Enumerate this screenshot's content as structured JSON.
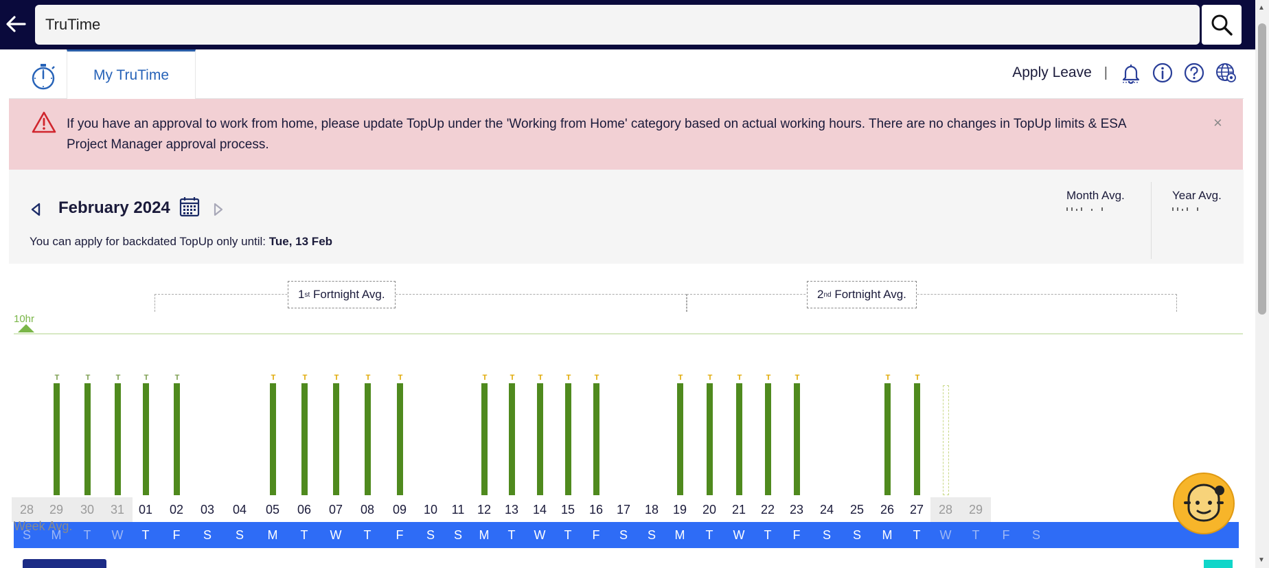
{
  "search": {
    "value": "TruTime"
  },
  "tabs": {
    "active_label": "My TruTime"
  },
  "header": {
    "apply_leave": "Apply Leave",
    "separator": "|"
  },
  "alert": {
    "text": "If you have an approval to work from home, please update TopUp under the 'Working from Home' category based on actual working hours. There are no changes in TopUp limits & ESA Project Manager approval process.",
    "close": "×"
  },
  "month": {
    "title": "February 2024",
    "backdate_prefix": "You can apply for backdated TopUp only until:",
    "backdate_date": "Tue, 13 Feb",
    "month_avg_label": "Month Avg.",
    "year_avg_label": "Year Avg."
  },
  "chart": {
    "fortnight1_num": "1",
    "fortnight1_sup": "st",
    "fortnight1_text": "Fortnight Avg.",
    "fortnight2_num": "2",
    "fortnight2_sup": "nd",
    "fortnight2_text": "Fortnight Avg.",
    "ten_hr_label": "10hr",
    "week_avg": "Week Avg.",
    "bar_marker": "T",
    "dates": [
      "28",
      "29",
      "30",
      "31",
      "01",
      "02",
      "03",
      "04",
      "05",
      "06",
      "07",
      "08",
      "09",
      "10",
      "11",
      "12",
      "13",
      "14",
      "15",
      "16",
      "17",
      "18",
      "19",
      "20",
      "21",
      "22",
      "23",
      "24",
      "25",
      "26",
      "27",
      "28",
      "29"
    ],
    "days": [
      "S",
      "M",
      "T",
      "W",
      "T",
      "F",
      "S",
      "S",
      "M",
      "T",
      "W",
      "T",
      "F",
      "S",
      "S",
      "M",
      "T",
      "W",
      "T",
      "F",
      "S",
      "S",
      "M",
      "T",
      "W",
      "T",
      "F",
      "S",
      "S",
      "M",
      "T",
      "W",
      "T",
      "F",
      "S"
    ]
  },
  "colors": {
    "bar": "#4f8a1e",
    "days_row": "#2e6cf6",
    "alert_bg": "#f2d0d4",
    "topbar": "#0a0a3c"
  }
}
